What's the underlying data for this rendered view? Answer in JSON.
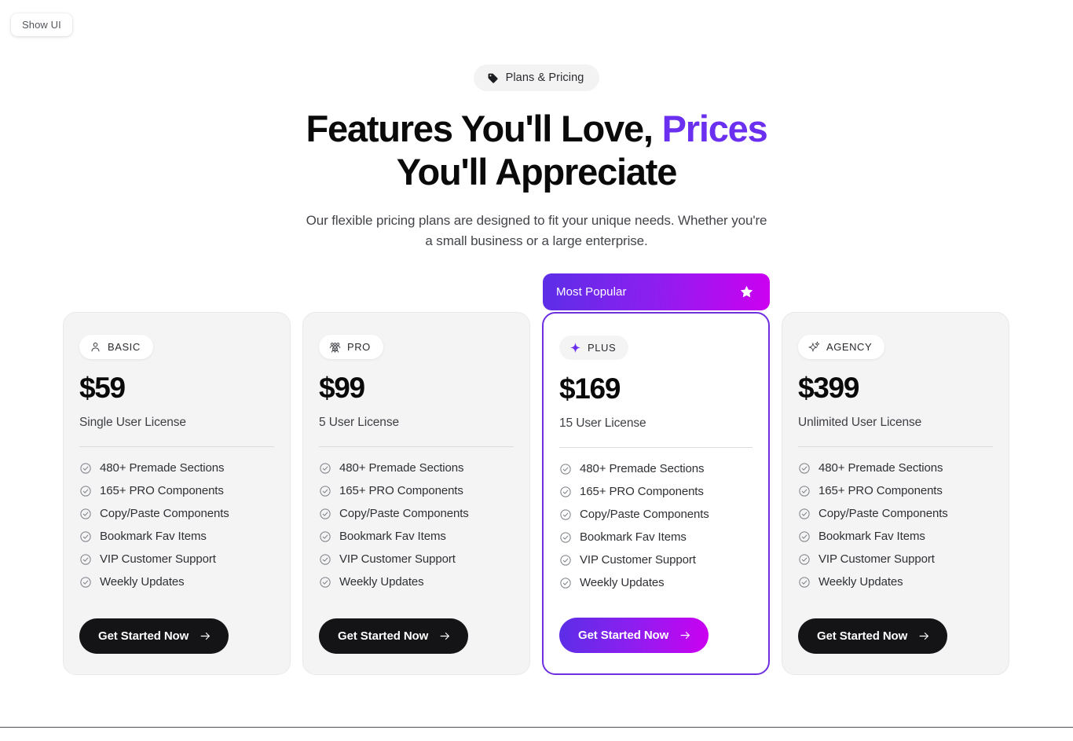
{
  "toolbar": {
    "show_ui_label": "Show UI"
  },
  "header": {
    "eyebrow": {
      "label": "Plans & Pricing",
      "icon": "tag-icon"
    },
    "headline_part1": "Features You'll Love, ",
    "headline_accent": "Prices",
    "headline_part2": " You'll Appreciate",
    "subtitle": "Our flexible pricing plans are designed to fit your unique needs. Whether you're a small business or a large enterprise."
  },
  "colors": {
    "accent_purple": "#6b2ff0",
    "gradient_start": "#5b2ee6",
    "gradient_mid": "#8c1ff0",
    "gradient_end": "#cc00f0",
    "card_bg": "#f4f4f5",
    "featured_border": "#6d2fe0",
    "cta_dark": "#141416"
  },
  "popular_ribbon": {
    "label": "Most Popular",
    "icon": "star-icon"
  },
  "plans": [
    {
      "id": "basic",
      "badge_label": "BASIC",
      "badge_icon": "user-icon",
      "price": "$59",
      "license": "Single User License",
      "featured": false,
      "cta_label": "Get Started Now",
      "cta_icon": "arrow-right-icon",
      "features": [
        "480+ Premade Sections",
        "165+ PRO Components",
        "Copy/Paste Components",
        "Bookmark Fav Items",
        "VIP Customer Support",
        "Weekly Updates"
      ]
    },
    {
      "id": "pro",
      "badge_label": "PRO",
      "badge_icon": "users-group-icon",
      "price": "$99",
      "license": "5 User License",
      "featured": false,
      "cta_label": "Get Started Now",
      "cta_icon": "arrow-right-icon",
      "features": [
        "480+ Premade Sections",
        "165+ PRO Components",
        "Copy/Paste Components",
        "Bookmark Fav Items",
        "VIP Customer Support",
        "Weekly Updates"
      ]
    },
    {
      "id": "plus",
      "badge_label": "PLUS",
      "badge_icon": "sparkle-icon",
      "price": "$169",
      "license": "15 User License",
      "featured": true,
      "cta_label": "Get Started Now",
      "cta_icon": "arrow-right-icon",
      "features": [
        "480+ Premade Sections",
        "165+ PRO Components",
        "Copy/Paste Components",
        "Bookmark Fav Items",
        "VIP Customer Support",
        "Weekly Updates"
      ]
    },
    {
      "id": "agency",
      "badge_label": "AGENCY",
      "badge_icon": "double-sparkle-icon",
      "price": "$399",
      "license": "Unlimited User License",
      "featured": false,
      "cta_label": "Get Started Now",
      "cta_icon": "arrow-right-icon",
      "features": [
        "480+ Premade Sections",
        "165+ PRO Components",
        "Copy/Paste Components",
        "Bookmark Fav Items",
        "VIP Customer Support",
        "Weekly Updates"
      ]
    }
  ]
}
